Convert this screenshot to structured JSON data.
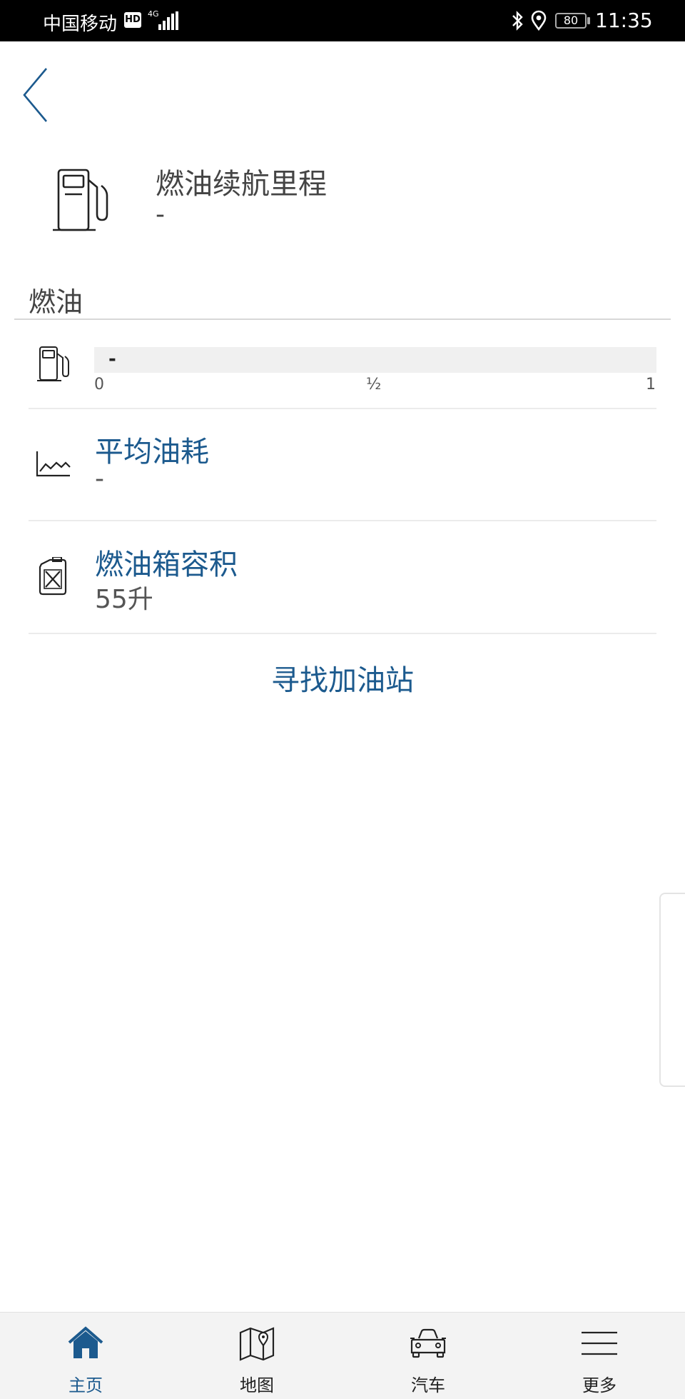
{
  "status_bar": {
    "carrier": "中国移动",
    "hd": "HD",
    "network": "4G",
    "battery": "80",
    "time": "11:35"
  },
  "header": {
    "back_icon": "chevron-left-icon"
  },
  "range": {
    "icon": "fuel-pump-icon",
    "title": "燃油续航里程",
    "value": "-"
  },
  "section": {
    "title": "燃油"
  },
  "fuel_gauge": {
    "icon": "fuel-pump-icon",
    "value": "-",
    "level": null,
    "ticks": [
      "0",
      "½",
      "1"
    ]
  },
  "rows": [
    {
      "icon": "line-chart-icon",
      "title": "平均油耗",
      "value": "-"
    },
    {
      "icon": "jerry-can-icon",
      "title": "燃油箱容积",
      "value": "55升"
    }
  ],
  "actions": {
    "find_station": "寻找加油站"
  },
  "bottom_nav": {
    "active": "home",
    "items": [
      {
        "id": "home",
        "icon": "home-icon",
        "label": "主页"
      },
      {
        "id": "map",
        "icon": "map-icon",
        "label": "地图"
      },
      {
        "id": "car",
        "icon": "car-icon",
        "label": "汽车"
      },
      {
        "id": "more",
        "icon": "menu-icon",
        "label": "更多"
      }
    ]
  },
  "colors": {
    "accent": "#1c5a8e",
    "status_bar_bg": "#000000",
    "nav_bg": "#f3f3f3"
  }
}
